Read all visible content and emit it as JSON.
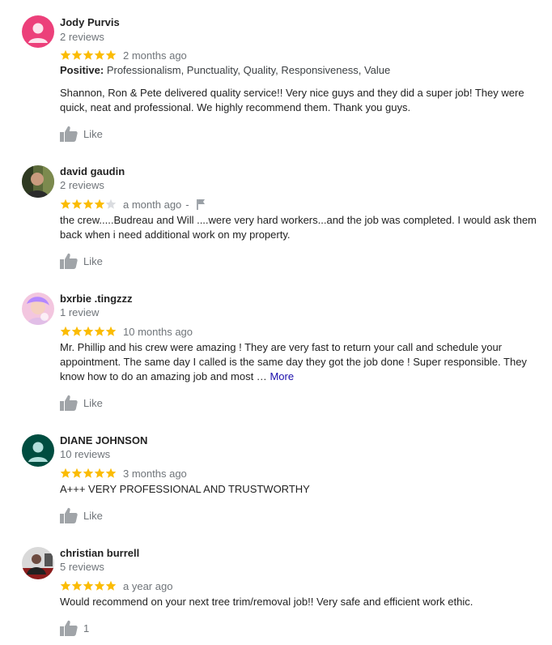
{
  "colors": {
    "star": "#fbbc04",
    "star_empty": "#dadce0",
    "meta": "#70757a",
    "link": "#1a0dab"
  },
  "reviews": [
    {
      "name": "Jody Purvis",
      "count": "2 reviews",
      "rating": 5,
      "ago": "2 months ago",
      "attributes_label": "Positive:",
      "attributes": "Professionalism, Punctuality, Quality, Responsiveness, Value",
      "text": "Shannon, Ron & Pete delivered quality service!!  Very nice guys and they did a super job!  They were quick, neat and professional.  We highly recommend them.  Thank you guys.",
      "like": "Like"
    },
    {
      "name": "david gaudin",
      "count": "2 reviews",
      "rating": 4,
      "ago": "a month ago",
      "dash": "-",
      "text": "the crew.....Budreau and Will ....were very hard workers...and the job was completed.  I would ask them back when i need additional work on my property.",
      "like": "Like"
    },
    {
      "name": "bxrbie .tingzzz",
      "count": "1 review",
      "rating": 5,
      "ago": "10 months ago",
      "text": "Mr. Phillip and his crew were amazing ! They are very fast to return your call and schedule your appointment. The same day I called is the same day they got the job done ! Super responsible. They know how to do an amazing job and most …",
      "more": "More",
      "like": "Like"
    },
    {
      "name": "DIANE JOHNSON",
      "count": "10 reviews",
      "rating": 5,
      "ago": "3 months ago",
      "text": "A+++ VERY PROFESSIONAL AND TRUSTWORTHY",
      "like": "Like"
    },
    {
      "name": "christian burrell",
      "count": "5 reviews",
      "rating": 5,
      "ago": "a year ago",
      "text": "Would recommend on your next tree trim/removal job!! Very safe and efficient work ethic.",
      "like": "1"
    }
  ]
}
